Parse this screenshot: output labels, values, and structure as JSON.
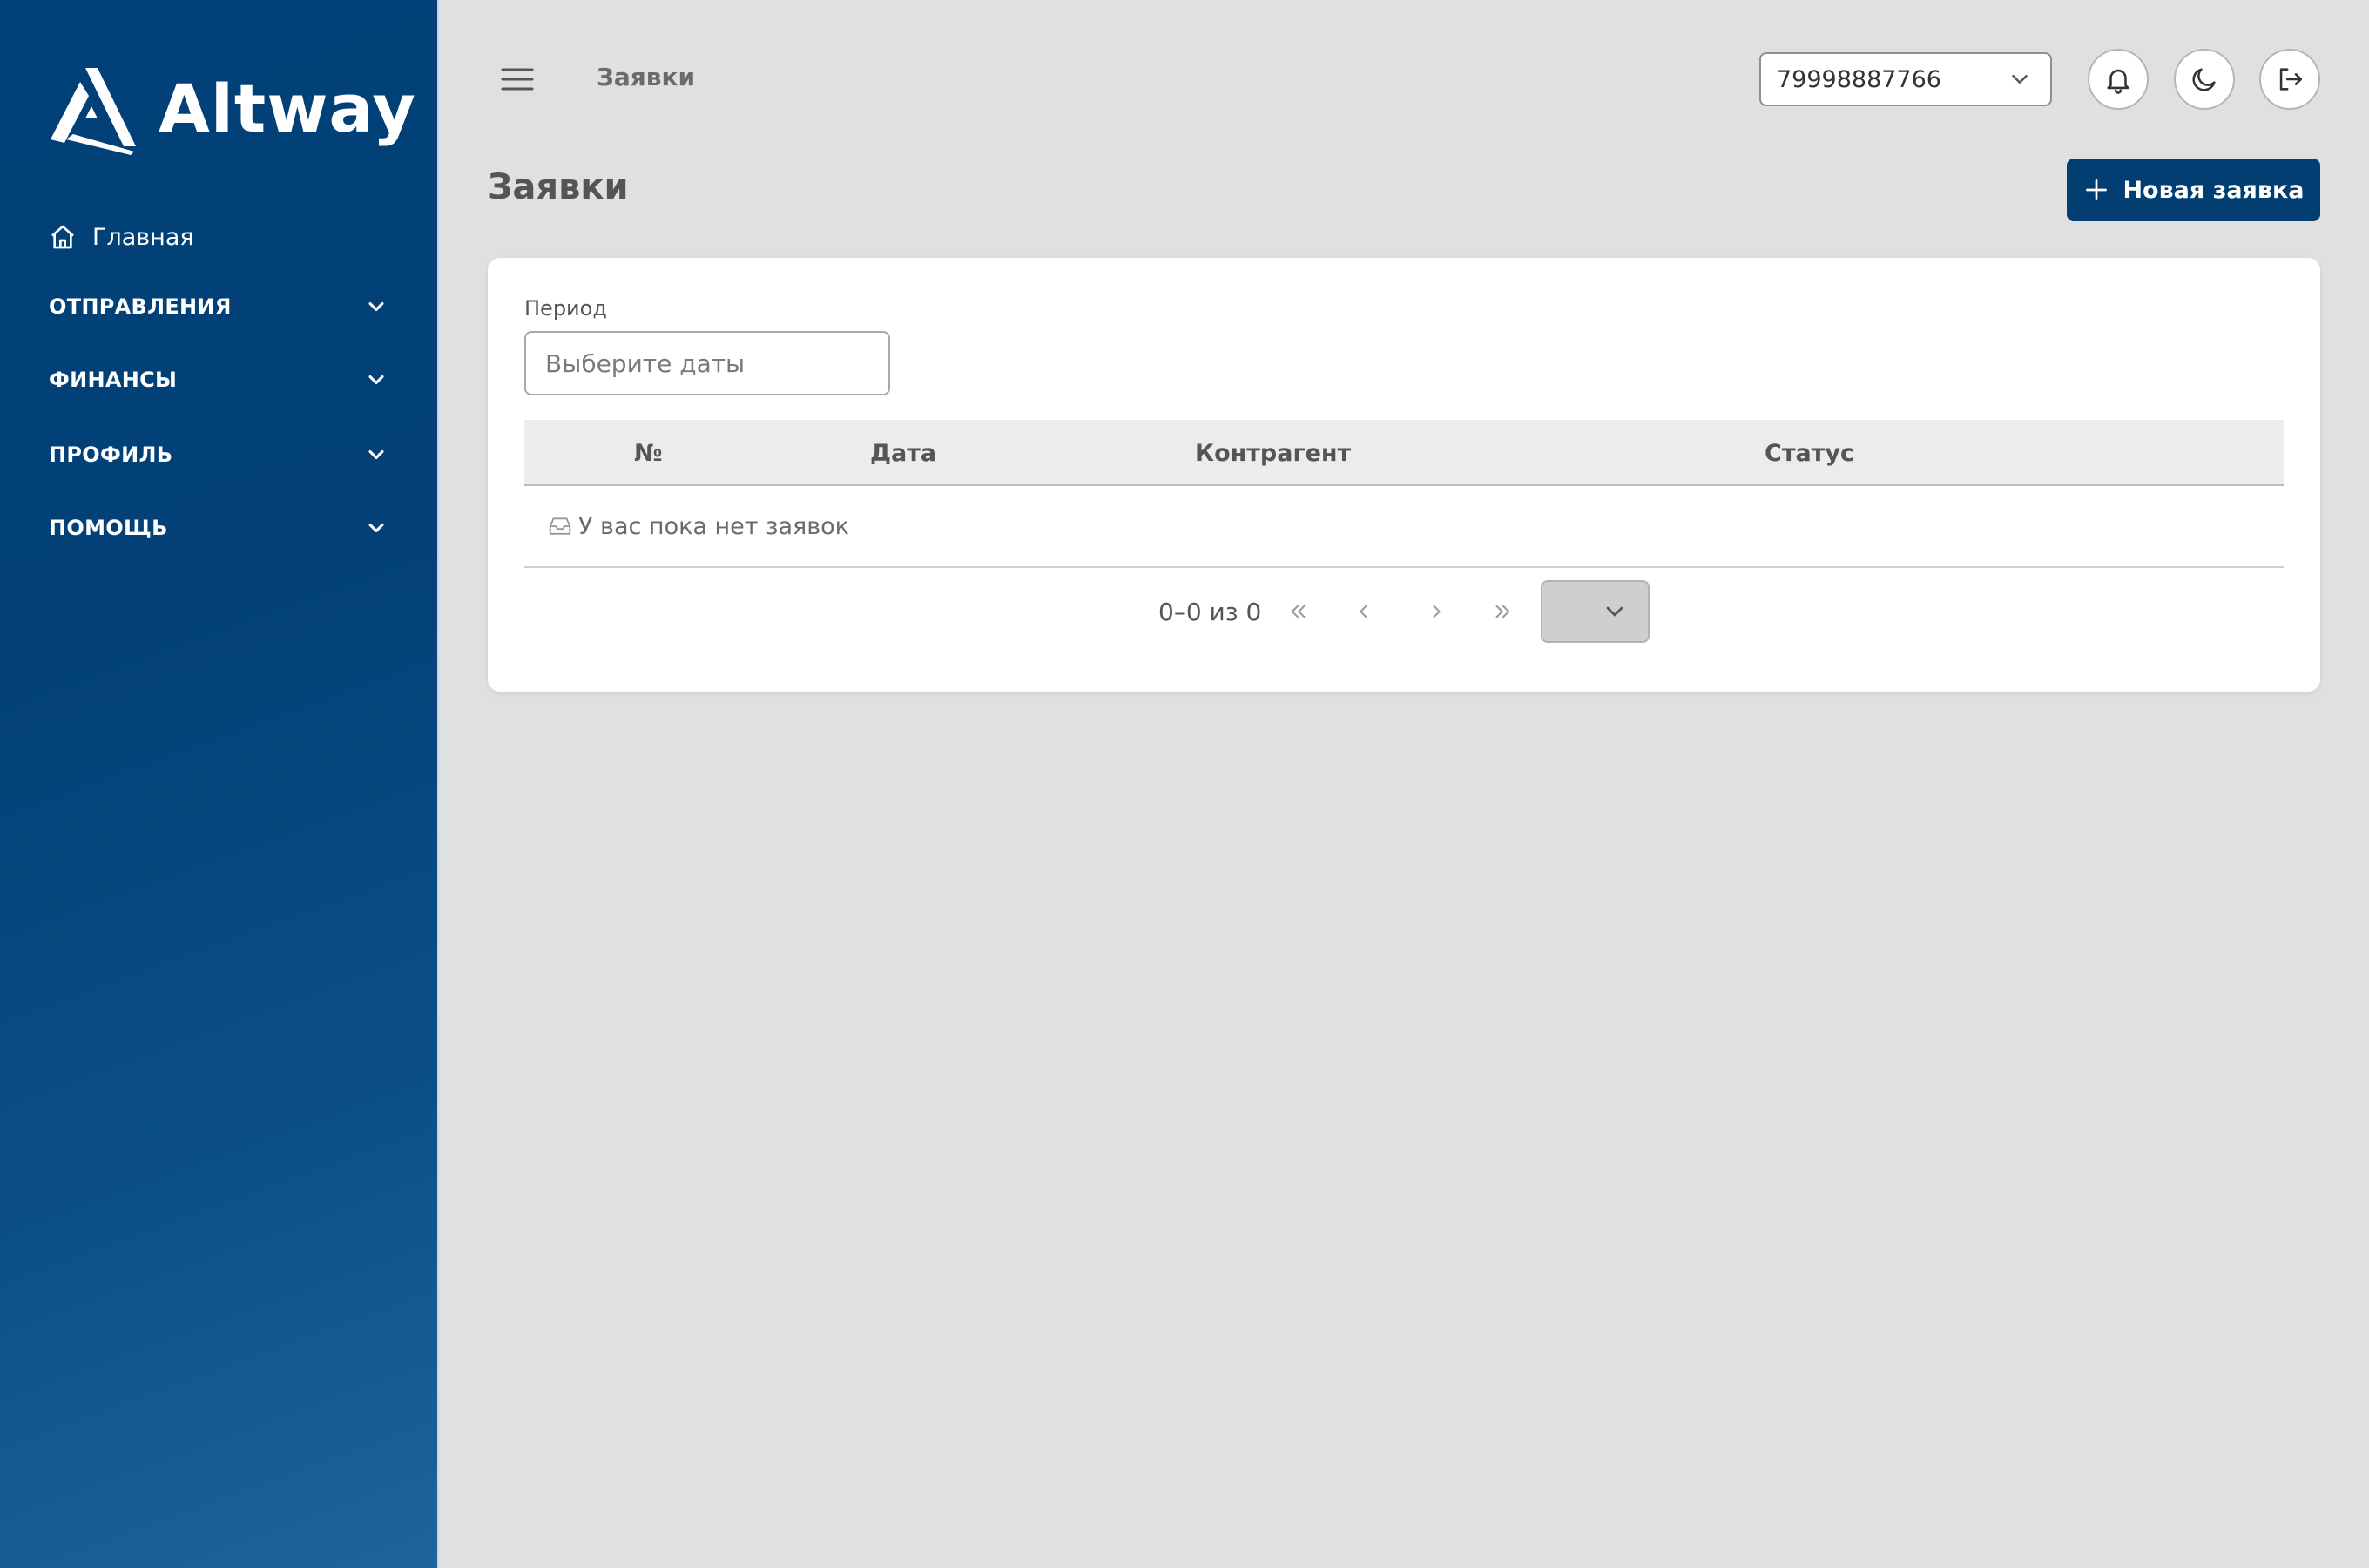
{
  "app": {
    "brand": "Altway"
  },
  "sidebar": {
    "home_label": "Главная",
    "sections": [
      {
        "label": "ОТПРАВЛЕНИЯ"
      },
      {
        "label": "ФИНАНСЫ"
      },
      {
        "label": "ПРОФИЛЬ"
      },
      {
        "label": "ПОМОЩЬ"
      }
    ]
  },
  "header": {
    "breadcrumb": "Заявки",
    "account_select_value": "79998887766"
  },
  "page": {
    "title": "Заявки",
    "new_button_label": "Новая заявка"
  },
  "filters": {
    "period_label": "Период",
    "period_placeholder": "Выберите даты"
  },
  "table": {
    "columns": [
      "№",
      "Дата",
      "Контрагент",
      "Статус"
    ],
    "empty_text": "У вас пока нет заявок"
  },
  "pagination": {
    "range_text": "0–0 из 0"
  },
  "colors": {
    "sidebar": "#013f78",
    "primary": "#033e73",
    "background": "#dfe0e0"
  }
}
